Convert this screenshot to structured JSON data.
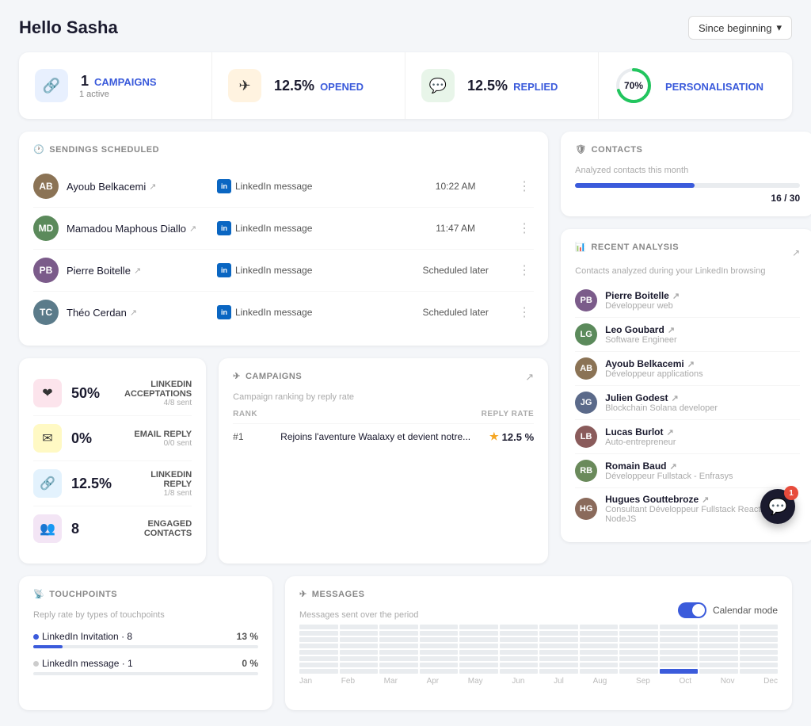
{
  "header": {
    "greeting": "Hello Sasha",
    "since_label": "Since beginning",
    "chevron": "▾"
  },
  "stats": [
    {
      "id": "campaigns",
      "icon": "🔗",
      "icon_class": "blue",
      "value": "1",
      "label": "CAMPAIGNS",
      "sub": "1 active"
    },
    {
      "id": "opened",
      "icon": "✈",
      "icon_class": "orange",
      "value": "12.5%",
      "label": "OPENED",
      "sub": ""
    },
    {
      "id": "replied",
      "icon": "💬",
      "icon_class": "green",
      "value": "12.5%",
      "label": "REPLIED",
      "sub": ""
    },
    {
      "id": "personalisation",
      "icon": "",
      "icon_class": "",
      "value": "70%",
      "label": "PERSONALISATION",
      "sub": ""
    }
  ],
  "sendings": {
    "title": "SENDINGS SCHEDULED",
    "rows": [
      {
        "name": "Ayoub Belkacemi",
        "type": "LinkedIn message",
        "time": "10:22 AM",
        "initials": "AB",
        "color": "#8b7355"
      },
      {
        "name": "Mamadou Maphous Diallo",
        "type": "LinkedIn message",
        "time": "11:47 AM",
        "initials": "MD",
        "color": "#5b8a5b"
      },
      {
        "name": "Pierre Boitelle",
        "type": "LinkedIn message",
        "time": "Scheduled later",
        "initials": "PB",
        "color": "#7b5b8a"
      },
      {
        "name": "Théo Cerdan",
        "type": "LinkedIn message",
        "time": "Scheduled later",
        "initials": "TC",
        "color": "#5b7b8a"
      }
    ]
  },
  "metrics": [
    {
      "id": "linkedin-accept",
      "icon": "❤",
      "icon_class": "pink",
      "value": "50%",
      "label": "LINKEDIN ACCEPTATIONS",
      "sub": "4/8 sent"
    },
    {
      "id": "email-reply",
      "icon": "✉",
      "icon_class": "yellow",
      "value": "0%",
      "label": "EMAIL REPLY",
      "sub": "0/0 sent"
    },
    {
      "id": "linkedin-reply",
      "icon": "🔗",
      "icon_class": "blue2",
      "value": "12.5%",
      "label": "LINKEDIN REPLY",
      "sub": "1/8 sent"
    },
    {
      "id": "engaged",
      "icon": "👥",
      "icon_class": "purple",
      "value": "8",
      "label": "ENGAGED CONTACTS",
      "sub": ""
    }
  ],
  "campaigns": {
    "title": "CAMPAIGNS",
    "sub": "Campaign ranking by reply rate",
    "rank_label": "RANK",
    "rate_label": "REPLY RATE",
    "rows": [
      {
        "rank": "#1",
        "name": "Rejoins l'aventure Waalaxy et devient notre...",
        "rate": "12.5 %"
      }
    ]
  },
  "contacts": {
    "title": "CONTACTS",
    "sub": "Analyzed contacts this month",
    "current": 16,
    "total": 30,
    "progress_pct": 53
  },
  "recent_analysis": {
    "title": "RECENT ANALYSIS",
    "sub": "Contacts analyzed during your LinkedIn browsing",
    "rows": [
      {
        "name": "Pierre Boitelle",
        "role": "Développeur web",
        "initials": "PB",
        "color": "#7b5b8a"
      },
      {
        "name": "Leo Goubard",
        "role": "Software Engineer",
        "initials": "LG",
        "color": "#5b8a5b"
      },
      {
        "name": "Ayoub Belkacemi",
        "role": "Développeur applications",
        "initials": "AB",
        "color": "#8b7355"
      },
      {
        "name": "Julien Godest",
        "role": "Blockchain Solana developer",
        "initials": "JG",
        "color": "#5b6a8a"
      },
      {
        "name": "Lucas Burlot",
        "role": "Auto-entrepreneur",
        "initials": "LB",
        "color": "#8a5b5b"
      },
      {
        "name": "Romain Baud",
        "role": "Développeur Fullstack - Enfrasys",
        "initials": "RB",
        "color": "#6a8a5b"
      },
      {
        "name": "Hugues Gouttebroze",
        "role": "Consultant Développeur Fullstack React Redux NodeJS",
        "initials": "HG",
        "color": "#8a6a5b"
      }
    ]
  },
  "touchpoints": {
    "title": "TOUCHPOINTS",
    "sub": "Reply rate by types of touchpoints",
    "rows": [
      {
        "label": "LinkedIn Invitation",
        "count": 8,
        "pct_label": "13 %",
        "pct": 13,
        "color": "blue"
      },
      {
        "label": "LinkedIn message",
        "count": 1,
        "pct_label": "0 %",
        "pct": 0,
        "color": "gray"
      }
    ]
  },
  "messages": {
    "title": "MESSAGES",
    "sub": "Messages sent over the period",
    "calendar_mode": "Calendar mode",
    "months": [
      "Jan",
      "Feb",
      "Mar",
      "Apr",
      "May",
      "Jun",
      "Jul",
      "Aug",
      "Sep",
      "Oct",
      "Nov",
      "Dec"
    ]
  },
  "chat": {
    "badge": "1"
  }
}
